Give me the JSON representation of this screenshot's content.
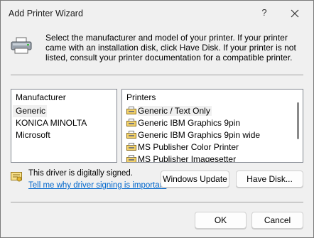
{
  "window": {
    "title": "Add Printer Wizard",
    "help_label": "?"
  },
  "intro_text": "Select the manufacturer and model of your printer. If your printer came with an installation disk, click Have Disk. If your printer is not listed, consult your printer documentation for a compatible printer.",
  "manufacturer_list": {
    "header": "Manufacturer",
    "items": [
      "Generic",
      "KONICA MINOLTA",
      "Microsoft"
    ],
    "selected": "Generic"
  },
  "printer_list": {
    "header": "Printers",
    "items": [
      "Generic / Text Only",
      "Generic IBM Graphics 9pin",
      "Generic IBM Graphics 9pin wide",
      "MS Publisher Color Printer",
      "MS Publisher Imagesetter"
    ],
    "selected": "Generic / Text Only"
  },
  "signature": {
    "status_text": "This driver is digitally signed.",
    "link_text": "Tell me why driver signing is important"
  },
  "buttons": {
    "windows_update": "Windows Update",
    "have_disk": "Have Disk...",
    "ok": "OK",
    "cancel": "Cancel"
  },
  "icons": {
    "title_close": "close-icon",
    "printer": "printer-icon",
    "list_printer": "printer-small-icon",
    "signed": "signed-driver-icon"
  }
}
